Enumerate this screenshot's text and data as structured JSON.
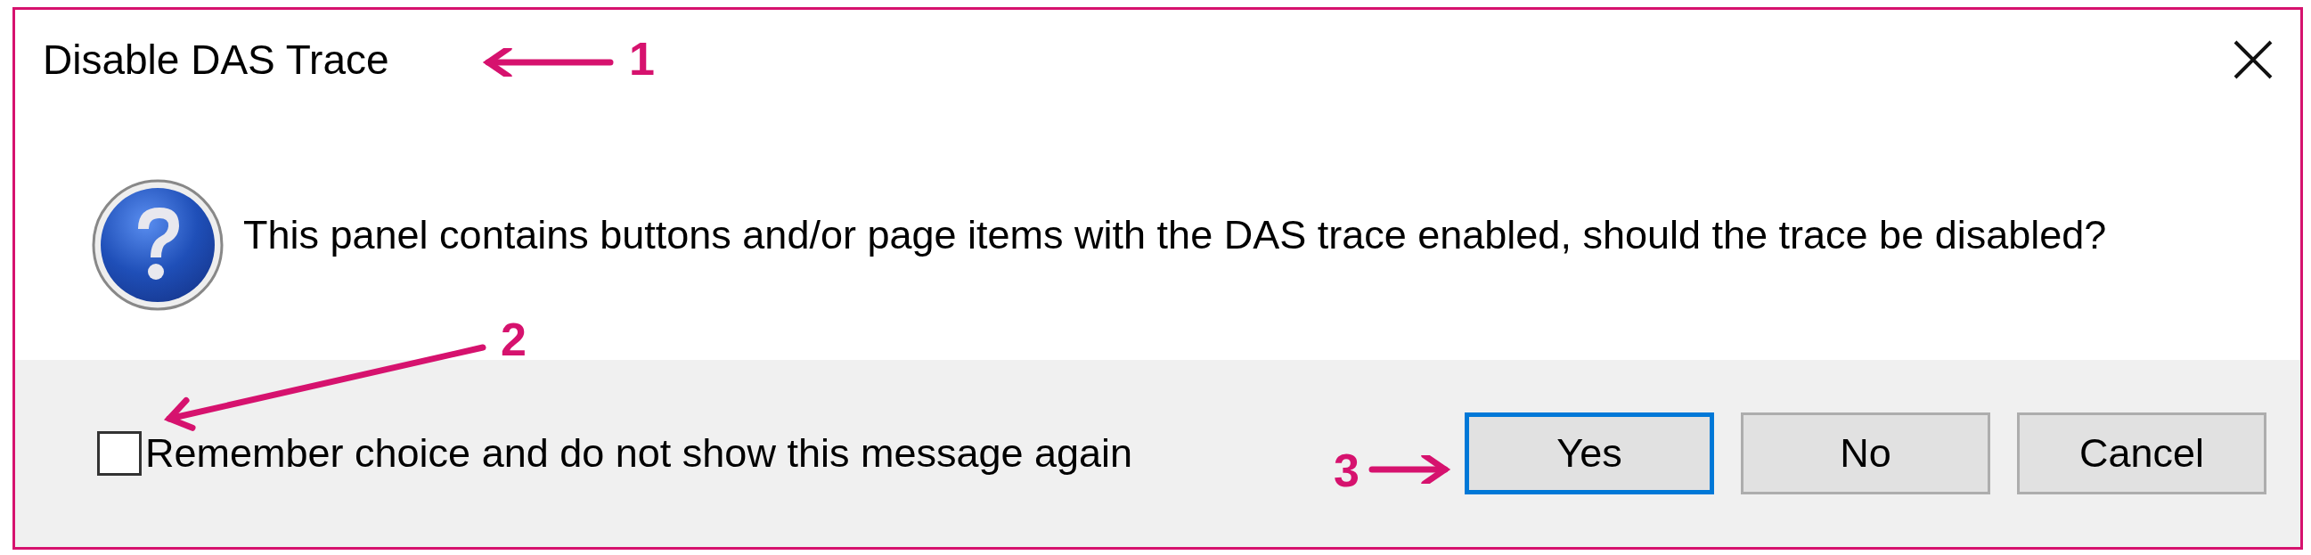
{
  "window": {
    "title": "Disable DAS Trace"
  },
  "message": {
    "text": "This panel contains buttons and/or page items with the DAS trace enabled, should the trace be disabled?"
  },
  "remember_checkbox": {
    "label": "Remember choice and do not show this message again",
    "checked": false
  },
  "buttons": [
    {
      "label": "Yes",
      "selected": true
    },
    {
      "label": "No",
      "selected": false
    },
    {
      "label": "Cancel",
      "selected": false
    }
  ],
  "annotations": [
    {
      "number": "1"
    },
    {
      "number": "2"
    },
    {
      "number": "3"
    }
  ]
}
